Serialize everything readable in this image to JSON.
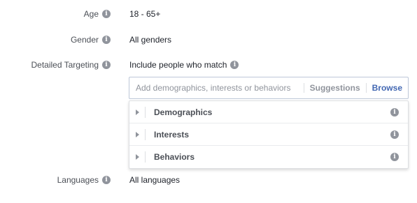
{
  "age": {
    "label": "Age",
    "value": "18 - 65+"
  },
  "gender": {
    "label": "Gender",
    "value": "All genders"
  },
  "detailed_targeting": {
    "label": "Detailed Targeting",
    "include_text": "Include people who match",
    "search": {
      "placeholder": "Add demographics, interests or behaviors",
      "suggestions_label": "Suggestions",
      "browse_label": "Browse"
    },
    "categories": [
      {
        "label": "Demographics"
      },
      {
        "label": "Interests"
      },
      {
        "label": "Behaviors"
      }
    ]
  },
  "languages": {
    "label": "Languages",
    "value": "All languages"
  },
  "colors": {
    "link": "#4267b2",
    "info_icon": "#90949c"
  },
  "icons": {
    "info": "info-icon",
    "expand": "triangle-right-icon"
  }
}
